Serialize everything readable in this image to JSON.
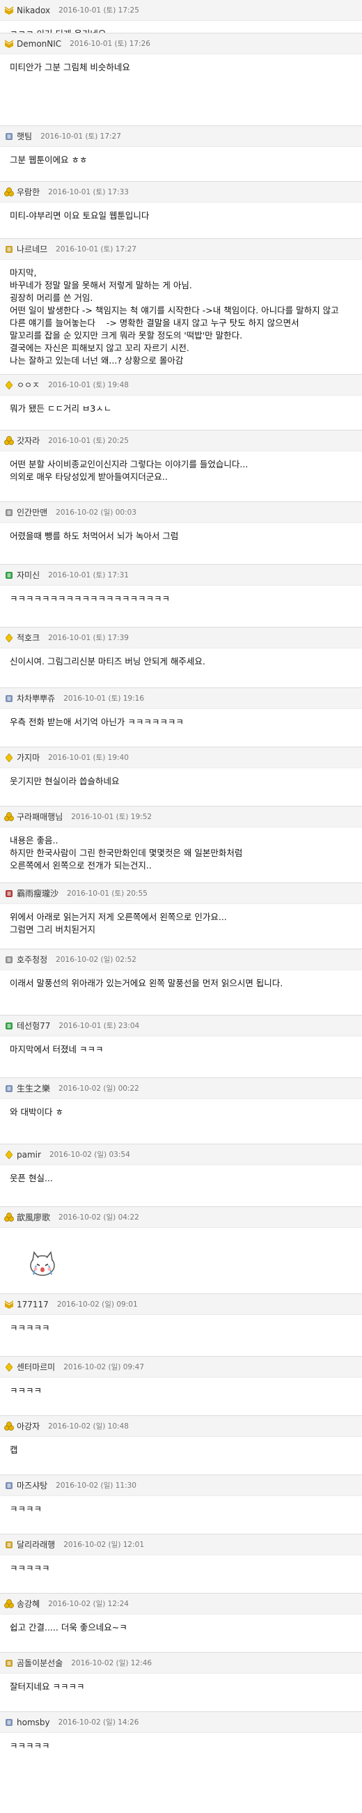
{
  "comments": [
    {
      "icon": "bookmark-icon",
      "icon_color": "#e0a800",
      "nick": "Nikadox",
      "date": "2016-10-01 (토) 17:25",
      "text": "ㅋㅋㅋ 이거 디게 웃기네요."
    },
    {
      "icon": "bookmark-icon",
      "icon_color": "#e0a800",
      "nick": "DemonNIC",
      "date": "2016-10-01 (토) 17:26",
      "text": "미티안가 그분 그림체 비슷하네요"
    },
    {
      "icon": "level-badge-icon",
      "icon_color": "#7a8fb5",
      "nick": "햇팀",
      "date": "2016-10-01 (토) 17:27",
      "text": "그분 웹툰이에요 ㅎㅎ"
    },
    {
      "icon": "gold-coins-icon",
      "icon_color": "#e8b400",
      "nick": "우람한",
      "date": "2016-10-01 (토) 17:33",
      "text": "미티-야부리면 이요 토요일 웹툰입니다"
    },
    {
      "icon": "level-badge-icon",
      "icon_color": "#c9a227",
      "nick": "나르네므",
      "date": "2016-10-01 (토) 17:27",
      "text": "마지막,\n바꾸네가 정말 말을 못해서 저렇게 말하는 게 아님.\n굉장히 머리를 쓴 거임.\n어떤 일이 발생한다 -> 책임지는 척 얘기를 시작한다 ->내 책임이다. 아니다를 말하지 않고\n다른 얘기를 늘어놓는다    -> 명확한 결말을 내지 않고 누구 탓도 하지 않으면서\n말꼬리를 잡을 순 있지만 크게 뭐라 못할 정도의 '떡밥'만 말한다.\n결국에는 자신은 피해보지 않고 꼬리 자르기 시전.\n나는 잘하고 있는데 너넌 왜...? 상황으로 몰아감"
    },
    {
      "icon": "diamond-icon",
      "icon_color": "#f2c200",
      "nick": "ㅇㅇㅈ",
      "date": "2016-10-01 (토) 19:48",
      "text": "뭐가 됐든 ㄷㄷ거리 ㅂ3ㅅㄴ"
    },
    {
      "icon": "gold-coins-icon",
      "icon_color": "#e8b400",
      "nick": "갓자라",
      "date": "2016-10-01 (토) 20:25",
      "text": "어떤 분할 사이비종교인이신지라 그렇다는 이야기를 들었습니다...\n의외로 매우 타당성있게 받아들여지더군요.."
    },
    {
      "icon": "level-badge-icon",
      "icon_color": "#8d8d8d",
      "nick": "인간만맨",
      "date": "2016-10-02 (일) 00:03",
      "text": "어렸을때 뺑를 하도 처먹어서 뇌가 녹아서 그럼"
    },
    {
      "icon": "level-badge-icon",
      "icon_color": "#2f9e44",
      "nick": "자미신",
      "date": "2016-10-01 (토) 17:31",
      "text": "ㅋㅋㅋㅋㅋㅋㅋㅋㅋㅋㅋㅋㅋㅋㅋㅋㅋㅋㅋㅋ"
    },
    {
      "icon": "diamond-icon",
      "icon_color": "#f2c200",
      "nick": "적호크",
      "date": "2016-10-01 (토) 17:39",
      "text": "신이시여. 그림그리신분 마티즈 버닝 안되게 해주세요."
    },
    {
      "icon": "level-badge-icon",
      "icon_color": "#7a8fb5",
      "nick": "차차뿌뿌쥬",
      "date": "2016-10-01 (토) 19:16",
      "text": "우측 전화 받는애 서기억 아닌가 ㅋㅋㅋㅋㅋㅋㅋ"
    },
    {
      "icon": "diamond-icon",
      "icon_color": "#f2c200",
      "nick": "가지마",
      "date": "2016-10-01 (토) 19:40",
      "text": "웃기지만 현실이라 씁슬하네요"
    },
    {
      "icon": "gold-coins-icon",
      "icon_color": "#e8b400",
      "nick": "구라패매행님",
      "date": "2016-10-01 (토) 19:52",
      "text": "내용은 좋음..\n하지만 한국사람이 그린 한국만화인데 몇몇컷은 왜 일본만화처럼\n오른쪽에서 왼쪽으로 전개가 되는건지.."
    },
    {
      "icon": "level-badge-icon",
      "icon_color": "#b03a3a",
      "nick": "霸雨瘦瓏沙",
      "date": "2016-10-01 (토) 20:55",
      "text": "위에서 아래로 읽는거지 저게 오른쪽에서 왼쪽으로 인가요...\n그럼면 그리 버치된거지"
    },
    {
      "icon": "level-badge-icon",
      "icon_color": "#8d8d8d",
      "nick": "호주청정",
      "date": "2016-10-02 (일) 02:52",
      "text": "이래서 말풍선의 위아래가 있는거에요 왼쪽 말풍선을 먼저 읽으시면 됩니다."
    },
    {
      "icon": "level-badge-icon",
      "icon_color": "#2f9e44",
      "nick": "테선헝77",
      "date": "2016-10-01 (토) 23:04",
      "text": "마지막에서 터졌네 ㅋㅋㅋ"
    },
    {
      "icon": "level-badge-icon",
      "icon_color": "#7a8fb5",
      "nick": "生生之樂",
      "date": "2016-10-02 (일) 00:22",
      "text": "와 대박이다 ㅎ"
    },
    {
      "icon": "diamond-icon",
      "icon_color": "#f2c200",
      "nick": "pamir",
      "date": "2016-10-02 (일) 03:54",
      "text": "웃픈 현실..."
    },
    {
      "icon": "gold-coins-icon",
      "icon_color": "#e8b400",
      "nick": "歆風廖歌",
      "date": "2016-10-02 (일) 04:22",
      "text": "",
      "sticker": "crying-cat-sticker"
    },
    {
      "icon": "bookmark-icon",
      "icon_color": "#e0a800",
      "nick": "177117",
      "date": "2016-10-02 (일) 09:01",
      "text": "ㅋㅋㅋㅋㅋ"
    },
    {
      "icon": "diamond-icon",
      "icon_color": "#f2c200",
      "nick": "센터마르미",
      "date": "2016-10-02 (일) 09:47",
      "text": "ㅋㅋㅋㅋ"
    },
    {
      "icon": "gold-coins-icon",
      "icon_color": "#e8b400",
      "nick": "아강자",
      "date": "2016-10-02 (일) 10:48",
      "text": "캡"
    },
    {
      "icon": "level-badge-icon",
      "icon_color": "#7a8fb5",
      "nick": "마즈샤탕",
      "date": "2016-10-02 (일) 11:30",
      "text": "ㅋㅋㅋㅋ"
    },
    {
      "icon": "level-badge-icon",
      "icon_color": "#c9a227",
      "nick": "달리라래행",
      "date": "2016-10-02 (일) 12:01",
      "text": "ㅋㅋㅋㅋㅋ"
    },
    {
      "icon": "gold-coins-icon",
      "icon_color": "#e8b400",
      "nick": "송강혜",
      "date": "2016-10-02 (일) 12:24",
      "text": "쉽고 간결..... 더욱 좋으네요~ㅋ"
    },
    {
      "icon": "level-badge-icon",
      "icon_color": "#c9a227",
      "nick": "곰돌이분선술",
      "date": "2016-10-02 (일) 12:46",
      "text": "잘터지네요 ㅋㅋㅋㅋ"
    },
    {
      "icon": "level-badge-icon",
      "icon_color": "#7a8fb5",
      "nick": "homsby",
      "date": "2016-10-02 (일) 14:26",
      "text": "ㅋㅋㅋㅋㅋ"
    }
  ]
}
